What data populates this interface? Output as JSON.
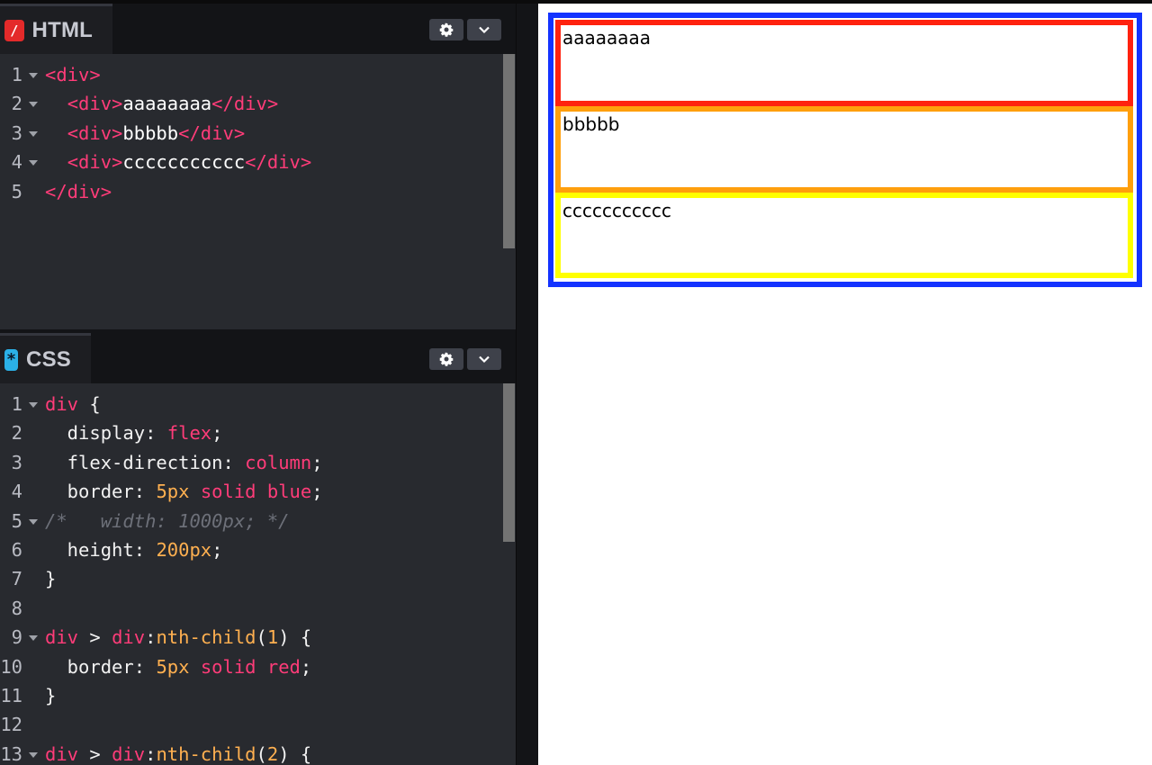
{
  "editors": {
    "html": {
      "title": "HTML",
      "badge": "/",
      "lines": [
        {
          "n": "1",
          "fold": true,
          "tokens": [
            {
              "c": "t-tag",
              "t": "<div>"
            }
          ]
        },
        {
          "n": "2",
          "fold": true,
          "tokens": [
            {
              "c": "t-punc",
              "t": "  "
            },
            {
              "c": "t-tag",
              "t": "<div>"
            },
            {
              "c": "t-text",
              "t": "aaaaaaaa"
            },
            {
              "c": "t-tag",
              "t": "</div>"
            }
          ]
        },
        {
          "n": "3",
          "fold": true,
          "tokens": [
            {
              "c": "t-punc",
              "t": "  "
            },
            {
              "c": "t-tag",
              "t": "<div>"
            },
            {
              "c": "t-text",
              "t": "bbbbb"
            },
            {
              "c": "t-tag",
              "t": "</div>"
            }
          ]
        },
        {
          "n": "4",
          "fold": true,
          "tokens": [
            {
              "c": "t-punc",
              "t": "  "
            },
            {
              "c": "t-tag",
              "t": "<div>"
            },
            {
              "c": "t-text",
              "t": "ccccccccccc"
            },
            {
              "c": "t-tag",
              "t": "</div>"
            }
          ]
        },
        {
          "n": "5",
          "fold": false,
          "tokens": [
            {
              "c": "t-tag",
              "t": "</div>"
            }
          ]
        }
      ]
    },
    "css": {
      "title": "CSS",
      "badge": "*",
      "lines": [
        {
          "n": "1",
          "fold": true,
          "tokens": [
            {
              "c": "t-sel",
              "t": "div"
            },
            {
              "c": "t-punc",
              "t": " {"
            }
          ]
        },
        {
          "n": "2",
          "fold": false,
          "tokens": [
            {
              "c": "t-prop",
              "t": "  display"
            },
            {
              "c": "t-punc",
              "t": ": "
            },
            {
              "c": "t-val",
              "t": "flex"
            },
            {
              "c": "t-punc",
              "t": ";"
            }
          ]
        },
        {
          "n": "3",
          "fold": false,
          "tokens": [
            {
              "c": "t-prop",
              "t": "  flex-direction"
            },
            {
              "c": "t-punc",
              "t": ": "
            },
            {
              "c": "t-val",
              "t": "column"
            },
            {
              "c": "t-punc",
              "t": ";"
            }
          ]
        },
        {
          "n": "4",
          "fold": false,
          "tokens": [
            {
              "c": "t-prop",
              "t": "  border"
            },
            {
              "c": "t-punc",
              "t": ": "
            },
            {
              "c": "t-num",
              "t": "5px"
            },
            {
              "c": "t-punc",
              "t": " "
            },
            {
              "c": "t-val",
              "t": "solid"
            },
            {
              "c": "t-punc",
              "t": " "
            },
            {
              "c": "t-val",
              "t": "blue"
            },
            {
              "c": "t-punc",
              "t": ";"
            }
          ]
        },
        {
          "n": "5",
          "fold": true,
          "tokens": [
            {
              "c": "t-cmt",
              "t": "/*   width: 1000px; */"
            }
          ]
        },
        {
          "n": "6",
          "fold": false,
          "tokens": [
            {
              "c": "t-prop",
              "t": "  height"
            },
            {
              "c": "t-punc",
              "t": ": "
            },
            {
              "c": "t-num",
              "t": "200px"
            },
            {
              "c": "t-punc",
              "t": ";"
            }
          ]
        },
        {
          "n": "7",
          "fold": false,
          "tokens": [
            {
              "c": "t-punc",
              "t": "}"
            }
          ]
        },
        {
          "n": "8",
          "fold": false,
          "tokens": []
        },
        {
          "n": "9",
          "fold": true,
          "tokens": [
            {
              "c": "t-sel",
              "t": "div"
            },
            {
              "c": "t-punc",
              "t": " > "
            },
            {
              "c": "t-sel",
              "t": "div"
            },
            {
              "c": "t-punc",
              "t": ":"
            },
            {
              "c": "t-pseudo",
              "t": "nth-child"
            },
            {
              "c": "t-punc",
              "t": "("
            },
            {
              "c": "t-num",
              "t": "1"
            },
            {
              "c": "t-punc",
              "t": ") {"
            }
          ]
        },
        {
          "n": "10",
          "fold": false,
          "tokens": [
            {
              "c": "t-prop",
              "t": "  border"
            },
            {
              "c": "t-punc",
              "t": ": "
            },
            {
              "c": "t-num",
              "t": "5px"
            },
            {
              "c": "t-punc",
              "t": " "
            },
            {
              "c": "t-val",
              "t": "solid"
            },
            {
              "c": "t-punc",
              "t": " "
            },
            {
              "c": "t-val",
              "t": "red"
            },
            {
              "c": "t-punc",
              "t": ";"
            }
          ]
        },
        {
          "n": "11",
          "fold": false,
          "tokens": [
            {
              "c": "t-punc",
              "t": "}"
            }
          ]
        },
        {
          "n": "12",
          "fold": false,
          "tokens": []
        },
        {
          "n": "13",
          "fold": true,
          "tokens": [
            {
              "c": "t-sel",
              "t": "div"
            },
            {
              "c": "t-punc",
              "t": " > "
            },
            {
              "c": "t-sel",
              "t": "div"
            },
            {
              "c": "t-punc",
              "t": ":"
            },
            {
              "c": "t-pseudo",
              "t": "nth-child"
            },
            {
              "c": "t-punc",
              "t": "("
            },
            {
              "c": "t-num",
              "t": "2"
            },
            {
              "c": "t-punc",
              "t": ") {"
            }
          ]
        }
      ]
    }
  },
  "preview": {
    "items": [
      "aaaaaaaa",
      "bbbbb",
      "ccccccccccc"
    ]
  },
  "icons": {
    "settings": "gear-icon",
    "collapse": "chevron-down-icon"
  },
  "colors": {
    "outer_border": "#1433ff",
    "child1_border": "#ff220f",
    "child2_border": "#ff9f0c",
    "child3_border": "#ffff00",
    "tag": "#ff3c79",
    "number": "#ffb050"
  }
}
